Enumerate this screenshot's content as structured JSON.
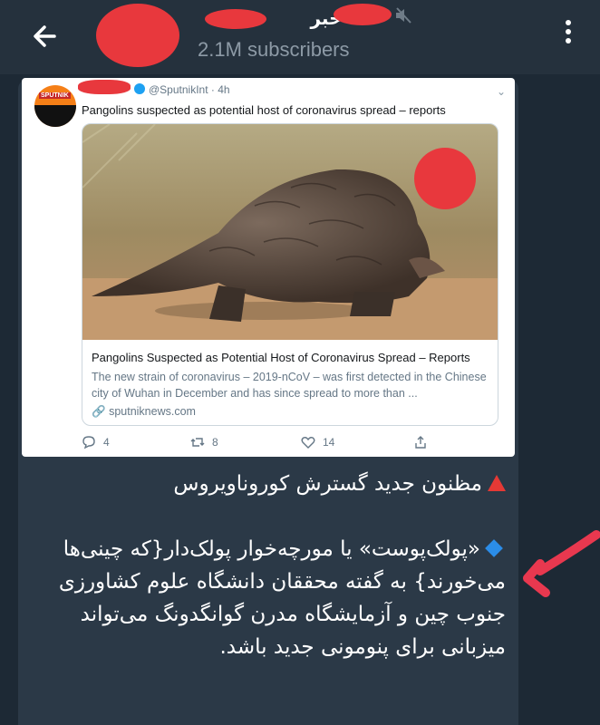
{
  "header": {
    "channel_name": "خبر",
    "subscribers": "2.1M subscribers",
    "back_icon": "arrow-left-icon",
    "menu_icon": "more-vertical-icon",
    "mute_icon": "muted-speaker-icon"
  },
  "tweet": {
    "handle_time": "@SputnikInt · 4h",
    "avatar_text": "SPUTNIK",
    "text": "Pangolins suspected as potential host of coronavirus spread – reports",
    "card_title": "Pangolins Suspected as Potential Host of Coronavirus Spread – Reports",
    "card_description": "The new strain of coronavirus – 2019-nCoV – was first detected in the Chinese city of Wuhan in December and has since spread to more than ...",
    "card_link": "sputniknews.com",
    "replies": "4",
    "retweets": "8",
    "likes": "14"
  },
  "message": {
    "headline": "مظنون جدید گسترش کوروناویروس",
    "body": "«پولک‌پوست» یا مورچه‌خوار پولک‌دار{که چینی‌ها می‌خورند} به گفته محققان دانشگاه علوم کشاورزی جنوب چین و آزمایشگاه مدرن گوانگدونگ می‌تواند میزبانی برای پنومونی جدید باشد."
  },
  "colors": {
    "header_bg": "#25313d",
    "bubble_bg": "#2b3947",
    "redaction": "#e8383d",
    "annotation_arrow": "#e8384f"
  }
}
